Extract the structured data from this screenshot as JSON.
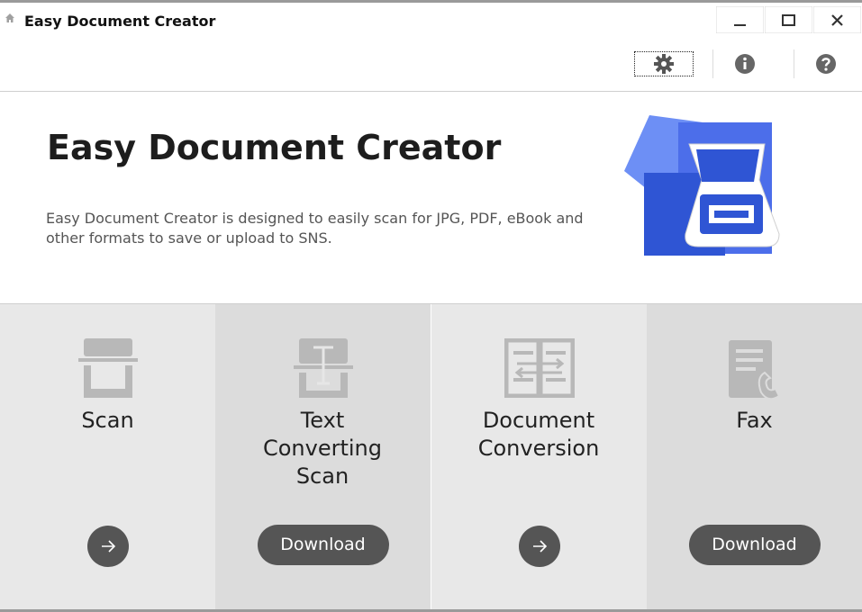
{
  "window": {
    "title": "Easy Document Creator",
    "controls": [
      "minimize",
      "maximize",
      "close"
    ]
  },
  "toolbar": {
    "buttons": [
      {
        "name": "settings",
        "icon": "gear-icon"
      },
      {
        "name": "info",
        "icon": "info-icon"
      },
      {
        "name": "help",
        "icon": "help-icon"
      }
    ]
  },
  "hero": {
    "title": "Easy Document Creator",
    "description": "Easy Document Creator is designed to easily scan for JPG, PDF, eBook and other formats to save or upload to SNS.",
    "logo_icon": "scanner-document-icon"
  },
  "features": [
    {
      "label": "Scan",
      "icon": "scanner-icon",
      "action": "arrow"
    },
    {
      "label": "Text Converting Scan",
      "icon": "text-scan-icon",
      "action": "download",
      "action_label": "Download"
    },
    {
      "label": "Document Conversion",
      "icon": "document-conversion-icon",
      "action": "arrow"
    },
    {
      "label": "Fax",
      "icon": "fax-icon",
      "action": "download",
      "action_label": "Download"
    }
  ],
  "colors": {
    "accent_blue": "#2f55d4",
    "light_blue": "#5b7ff0",
    "button_dark": "#555555",
    "panel_light": "#e8e8e8",
    "panel_dark": "#dcdcdc",
    "icon_gray": "#b8b8b8"
  }
}
